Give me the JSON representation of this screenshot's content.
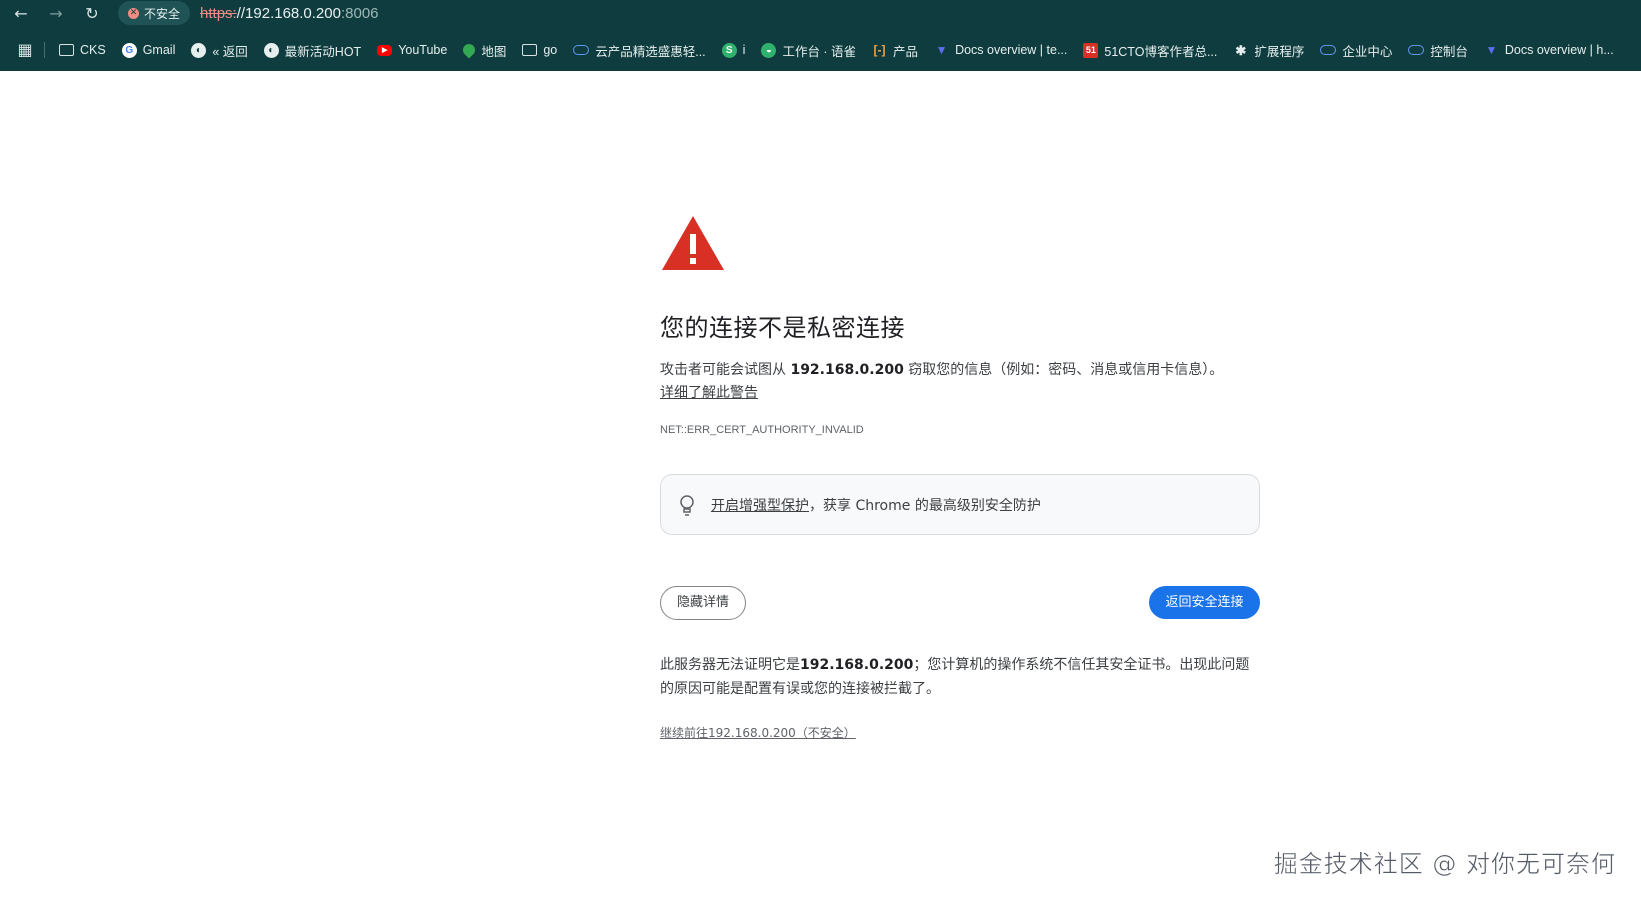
{
  "browser": {
    "security_chip_label": "不安全",
    "url_scheme": "https:",
    "url_host": "//192.168.0.200",
    "url_port": ":8006"
  },
  "bookmarks": [
    {
      "label": "CKS",
      "icon": "folder-icon"
    },
    {
      "label": "Gmail",
      "icon": "google-icon"
    },
    {
      "label": "« 返回",
      "icon": "globe-icon"
    },
    {
      "label": "最新活动HOT",
      "icon": "globe-icon"
    },
    {
      "label": "YouTube",
      "icon": "youtube-icon"
    },
    {
      "label": "地图",
      "icon": "maps-icon"
    },
    {
      "label": "go",
      "icon": "folder-icon"
    },
    {
      "label": "云产品精选盛惠轻...",
      "icon": "cloud-icon"
    },
    {
      "label": "i",
      "icon": "green-icon"
    },
    {
      "label": "工作台 · 语雀",
      "icon": "green-icon"
    },
    {
      "label": "产品",
      "icon": "bracket-icon"
    },
    {
      "label": "Docs overview | te...",
      "icon": "terraform-icon"
    },
    {
      "label": "51CTO博客作者总...",
      "icon": "51cto-icon"
    },
    {
      "label": "扩展程序",
      "icon": "puzzle-icon"
    },
    {
      "label": "企业中心",
      "icon": "cloud-icon"
    },
    {
      "label": "控制台",
      "icon": "cloud-icon"
    },
    {
      "label": "Docs overview | h...",
      "icon": "terraform-icon"
    }
  ],
  "interstitial": {
    "heading": "您的连接不是私密连接",
    "body_prefix": "攻击者可能会试图从 ",
    "body_host": "192.168.0.200",
    "body_suffix": " 窃取您的信息（例如：密码、消息或信用卡信息）。",
    "learn_more": "详细了解此警告",
    "error_code": "NET::ERR_CERT_AUTHORITY_INVALID",
    "enhanced_link": "开启增强型保护",
    "enhanced_rest": "，获享 Chrome 的最高级别安全防护",
    "hide_details_label": "隐藏详情",
    "back_to_safety_label": "返回安全连接",
    "details_prefix": "此服务器无法证明它是",
    "details_host": "192.168.0.200",
    "details_suffix": "；您计算机的操作系统不信任其安全证书。出现此问题的原因可能是配置有误或您的连接被拦截了。",
    "proceed_link": "继续前往192.168.0.200（不安全）"
  },
  "watermark": "掘金技术社区 @ 对你无可奈何",
  "colors": {
    "toolbar_bg": "#0f3d3f",
    "primary_button": "#1a73e8",
    "warning_red": "#d93025"
  }
}
